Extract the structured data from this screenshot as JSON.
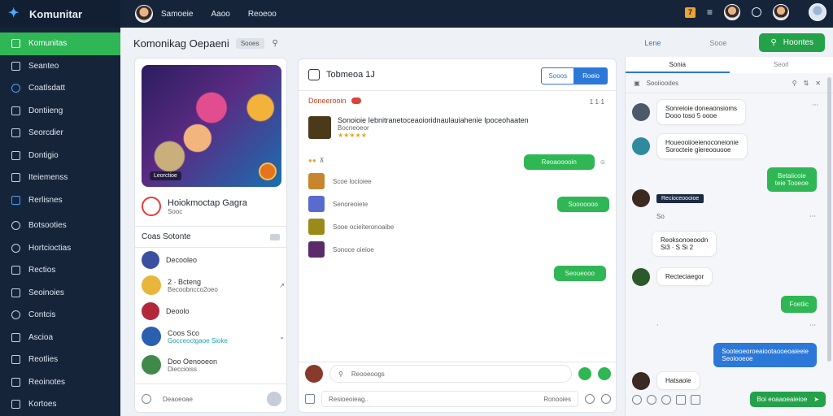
{
  "app": {
    "name": "Komunitar"
  },
  "sidebar": {
    "items": [
      {
        "label": "Komunitas"
      },
      {
        "label": "Seanteo"
      },
      {
        "label": "Coatlsdatt"
      },
      {
        "label": "Dontiieng"
      },
      {
        "label": "Seorcdier"
      },
      {
        "label": "Dontigio"
      },
      {
        "label": "Iteiemenss"
      },
      {
        "label": "Rerlisnes"
      },
      {
        "label": "Botsooties"
      },
      {
        "label": "Hortcioctias"
      },
      {
        "label": "Rectios"
      },
      {
        "label": "Seoinoies"
      },
      {
        "label": "Contcis"
      },
      {
        "label": "Ascioa"
      },
      {
        "label": "Reotlies"
      },
      {
        "label": "Reoinotes"
      },
      {
        "label": "Kortoes"
      }
    ]
  },
  "topbar": {
    "tabs": [
      "Samoeie",
      "Aaoo",
      "Reoeoo"
    ],
    "badge": "7"
  },
  "header": {
    "title": "Komonikag Oepaeni",
    "pill": "Sooes",
    "tabs": [
      "Lene",
      "Sooe"
    ],
    "action": "Hoontes"
  },
  "left_panel": {
    "game_tag": "Leorctioe",
    "game_title": "Hoiokmoctap Gagra",
    "game_sub": "Sooc",
    "section": "Coas Sotonte",
    "contacts": [
      {
        "name": "Decooleo",
        "sub": ""
      },
      {
        "name": "2 · Bcteng",
        "sub": "Becoobncco2oeo"
      },
      {
        "name": "Deoolo",
        "sub": ""
      },
      {
        "name": "Coos Sco",
        "sub": "Gocceoctgaoe Sioke"
      },
      {
        "name": "Doo Oenooeon",
        "sub": "Dieccioiss"
      }
    ],
    "footer": "Deaoeoae"
  },
  "mid_panel": {
    "title": "Tobmeoa 1J",
    "btn_left": "Sooos",
    "btn_right": "Roeio",
    "section": "Doneerooin",
    "timestamp": "1 1·1",
    "post_title": "Sonoioie Iebnitranetoceaoioridnaulauiahenie Ipoceohaaten",
    "post_sub": "Bocneoeor",
    "bubble1": "Reoaooooin",
    "items": [
      "Scoe locioiee",
      "Senoreoiete",
      "Sooe ocieiteronoaibe",
      "Sonoce oieioe"
    ],
    "bubble2": "Sooooooo",
    "bubble3": "Seoueooo",
    "input_placeholder": "Reooeoogs",
    "footer_left": "Resioeoieag..",
    "footer_right": "Ronooies"
  },
  "right_panel": {
    "tabs": [
      "Sonia",
      "Seorl"
    ],
    "search": "Sooiioodes",
    "messages": [
      {
        "side": "left",
        "text": "Sonreioie doneaonsioms\nDooo toso 5 oooe"
      },
      {
        "side": "left",
        "text": "Houeooiioeienoconeionie\nSorocteie giereoouooe"
      },
      {
        "side": "right-green",
        "text": "Betaiicoie\nteie Tooeoe"
      },
      {
        "side": "left-tag",
        "text": "Recioceoooioe"
      },
      {
        "side": "center",
        "text": "So"
      },
      {
        "side": "left",
        "text": "Reoksonoeoodn\nSi3 · S  Si  2"
      },
      {
        "side": "left",
        "text": "Recteciaegor"
      },
      {
        "side": "right-green",
        "text": "Foetiic"
      },
      {
        "side": "right-blue",
        "text": "Sooteoeoroeaiootaooeoaieeie\nSeoiooeoe"
      },
      {
        "side": "left",
        "text": "Hatsaoie"
      }
    ],
    "footer_btn": "Boi eoaaoeaieioe"
  },
  "colors": {
    "sidebar": "#16243a",
    "accent_green": "#2fb655",
    "accent_blue": "#2b78d8"
  }
}
